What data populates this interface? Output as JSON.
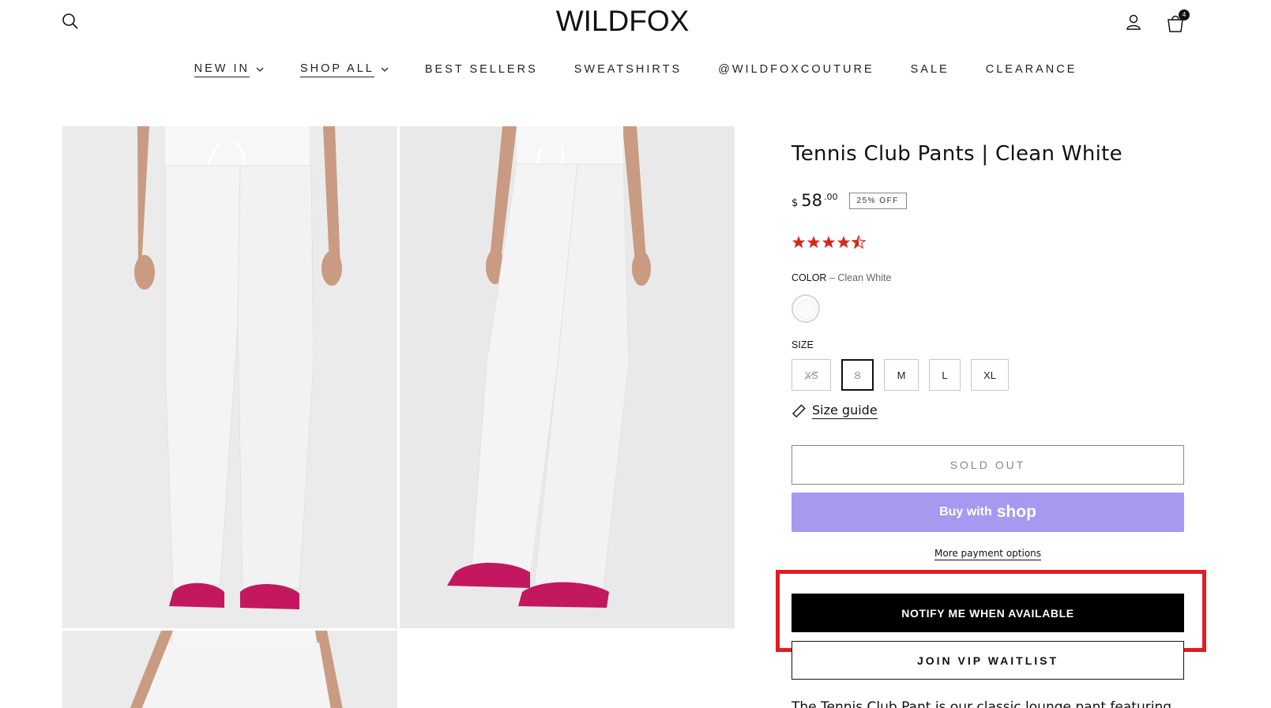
{
  "header": {
    "logo": "WILDFOX",
    "cart_count": "4",
    "icons": [
      "search-icon",
      "account-icon",
      "bag-icon"
    ]
  },
  "nav": {
    "items": [
      {
        "label": "NEW IN",
        "has_dropdown": true
      },
      {
        "label": "SHOP ALL",
        "has_dropdown": true
      },
      {
        "label": "BEST SELLERS",
        "has_dropdown": false
      },
      {
        "label": "SWEATSHIRTS",
        "has_dropdown": false
      },
      {
        "label": "@WILDFOXCOUTURE",
        "has_dropdown": false
      },
      {
        "label": "SALE",
        "has_dropdown": false
      },
      {
        "label": "CLEARANCE",
        "has_dropdown": false
      }
    ]
  },
  "product": {
    "title": "Tennis Club Pants | Clean White",
    "price_currency": "$",
    "price_main": "58",
    "price_cents": ".00",
    "discount_badge": "25% OFF",
    "rating": 4.5,
    "star_color": "#d42b1e",
    "color_label": "COLOR",
    "color_sep": " – ",
    "color_value": "Clean White",
    "size_label": "SIZE",
    "sizes": [
      {
        "label": "XS",
        "available": false,
        "selected": false
      },
      {
        "label": "S",
        "available": false,
        "selected": true
      },
      {
        "label": "M",
        "available": true,
        "selected": false
      },
      {
        "label": "L",
        "available": true,
        "selected": false
      },
      {
        "label": "XL",
        "available": true,
        "selected": false
      }
    ],
    "size_guide": "Size guide",
    "sold_out_label": "SOLD OUT",
    "shop_pay_prefix": "Buy with",
    "shop_pay_brand": "shop",
    "more_payment": "More payment options",
    "notify_label": "NOTIFY ME WHEN AVAILABLE",
    "vip_label": "JOIN VIP WAITLIST",
    "description": "The Tennis Club Pant is our classic lounge pant featuring"
  },
  "colors": {
    "accent_purple": "#a798f0",
    "highlight_red": "#e31b23"
  }
}
